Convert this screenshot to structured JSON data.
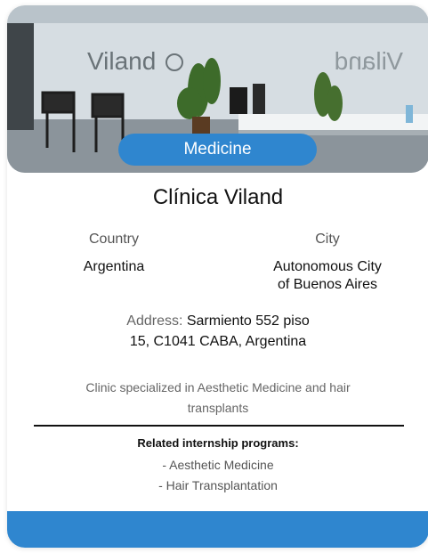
{
  "card": {
    "category_badge": "Medicine",
    "photo_logo_text": "Viland",
    "title": "Clínica Viland",
    "country_label": "Country",
    "country_value": "Argentina",
    "city_label": "City",
    "city_value_line1": "Autonomous City",
    "city_value_line2": "of Buenos Aires",
    "address_label": "Address:",
    "address_line1": "Sarmiento 552 piso",
    "address_line2": "15, C1041 CABA, Argentina",
    "description_line1": "Clinic specialized in Aesthetic Medicine and hair",
    "description_line2": "transplants",
    "related_title": "Related internship programs:",
    "related_programs": [
      "- Aesthetic Medicine",
      "- Hair Transplantation"
    ]
  },
  "colors": {
    "accent": "#2f86cf",
    "photo_wall": "#c9d1d7",
    "text_primary": "#111111",
    "text_muted": "#666666"
  }
}
